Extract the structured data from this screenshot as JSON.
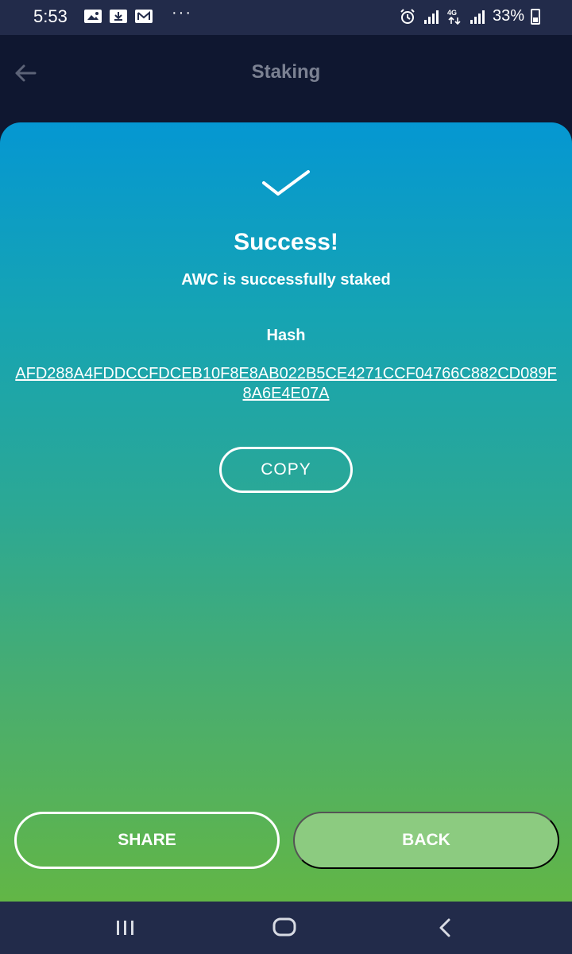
{
  "status_bar": {
    "time": "5:53",
    "battery": "33%",
    "icons": [
      "gallery-icon",
      "download-icon",
      "mail-icon",
      "more-dots-icon",
      "alarm-icon",
      "signal-icon",
      "4g-icon",
      "signal-icon",
      "battery-icon"
    ],
    "more": "···"
  },
  "app_bar": {
    "title": "Staking",
    "back_icon": "back-arrow-icon"
  },
  "result": {
    "icon": "checkmark-icon",
    "title": "Success!",
    "message": "AWC is successfully staked",
    "hash_label": "Hash",
    "hash_value": "AFD288A4FDDCCFDCEB10F8E8AB022B5CE4271CCF04766C882CD089F8A6E4E07A",
    "copy_label": "COPY"
  },
  "actions": {
    "share_label": "SHARE",
    "back_label": "BACK"
  },
  "colors": {
    "gradient_top": "#0597d2",
    "gradient_bottom": "#62b646",
    "back_button": "#8ccb80",
    "background": "#0f1730",
    "title_gray": "#7b8192"
  },
  "nav_bar": {
    "icons": [
      "recent-apps-icon",
      "home-icon",
      "back-icon"
    ]
  }
}
